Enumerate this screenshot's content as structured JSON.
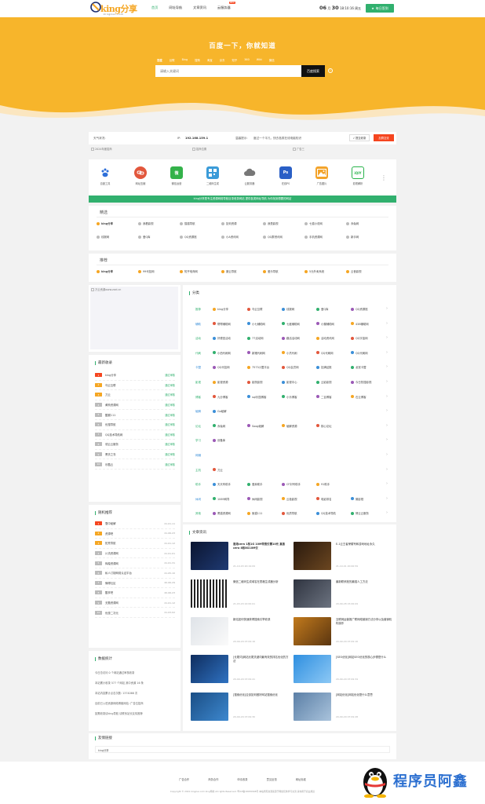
{
  "header": {
    "logo_text": "king",
    "logo_text_cn": "分享",
    "logo_url": "kingzuo.com",
    "nav": [
      "首页",
      "网址导航",
      "文章资讯",
      "云服务器"
    ],
    "nav_badge": "NEW",
    "date_month": "06",
    "date_month_unit": "月",
    "date_day": "30",
    "date_time": "18:10:16 周五",
    "signin": "每日签到"
  },
  "hero": {
    "title": "百度一下，你就知道",
    "engines": [
      "百度",
      "谷歌",
      "Bing",
      "搜狗",
      "淘宝",
      "京东",
      "知乎",
      "360",
      "Wiki",
      "微信"
    ],
    "placeholder": "请输入关键词",
    "search_button": "百度搜索"
  },
  "infobar": {
    "weather": "天气状况:",
    "ip_label": "IP:",
    "ip_value": "192.168.159.1",
    "tip_label": "温馨提示:",
    "tip_text": "度过一个平凡，快去各类在线电脑知识",
    "contribute": "√ 提交收录",
    "hot_button": "加群交流"
  },
  "ads": [
    "2024年度招商",
    "招商位置",
    "广告三"
  ],
  "apps": [
    {
      "label": "百度工具",
      "icon": "baidu-icon",
      "color": "#2e6fd9"
    },
    {
      "label": "网址压缩",
      "icon": "link-icon",
      "color": "#e2573c"
    },
    {
      "label": "微信运营",
      "icon": "wechat-icon",
      "color": "#34b24a"
    },
    {
      "label": "二维码生成",
      "icon": "qrcode-icon",
      "color": "#3b9bd8"
    },
    {
      "label": "云服务器",
      "icon": "cloud-icon",
      "color": "#777777"
    },
    {
      "label": "在线PS",
      "icon": "ps-icon",
      "color": "#2a5fc6"
    },
    {
      "label": "广告图片",
      "icon": "image-icon",
      "color": "#f3a32a"
    },
    {
      "label": "影视解析",
      "icon": "iqiyi-icon",
      "color": "#28b34a"
    }
  ],
  "notice": "king分享是专注资源网络导航目录收录网站 提供各类网址导航 为你找到想要的网站",
  "featured": {
    "title": "精选",
    "links": [
      "king分享",
      "我看影视",
      "猫猫导航",
      "如何资源",
      "我是影视",
      "七猫小说网",
      "赤兔网",
      "线报网",
      "爱Q库",
      "QQ资源馆",
      "小A资讯网",
      "QQ群资讯网",
      "手机资源网",
      "新手网"
    ]
  },
  "recommend": {
    "title": "推荐",
    "links": [
      "king分享",
      "99代挂网",
      "知乎电商网",
      "魔云导航",
      "爱乐导航",
      "5元外卖系统",
      "云音影视"
    ]
  },
  "left_ad": "万云资源www.zsei.cn",
  "latest": {
    "title": "最新收录",
    "status": "通过审核",
    "items": [
      "king分享",
      "乌云互联",
      "刀云",
      "黄狗资源网",
      "酷猴111",
      "优搜导航",
      "QQ技术导航网",
      "领云云服务",
      "黑衣之衣",
      "乐酷云"
    ]
  },
  "random": {
    "title": "随机推荐",
    "items": [
      {
        "name": "雪中破解",
        "date": "21-01-11"
      },
      {
        "name": "资源吧",
        "date": "21-06-23"
      },
      {
        "name": "拓荒导航",
        "date": "21-01-12"
      },
      {
        "name": "川流资源网",
        "date": "21-01-01"
      },
      {
        "name": "辉煌资源网",
        "date": "21-01-31"
      },
      {
        "name": "私人订制网络认证平台",
        "date": "21-05-10"
      },
      {
        "name": "懂得社区",
        "date": "20-06-29"
      },
      {
        "name": "酷享吧",
        "date": "20-06-23"
      },
      {
        "name": "无题资源网",
        "date": "21-01-12"
      },
      {
        "name": "优惠二次元",
        "date": "21-03-02"
      }
    ]
  },
  "stats": {
    "title": "数据统计",
    "lines": [
      "今日总访问  0  个网站通过审核收录",
      "本站累计收录  577  个网站 其中资源  16  条",
      "本站内容累计点击次数: 1374066 次",
      "目前已入驻资源网络博客网站: 广告位招商",
      "如需收录请king导航 请联系站长友情推荐"
    ]
  },
  "categories": {
    "title": "分类",
    "rows": [
      {
        "name": "推荐",
        "items": [
          "king分享",
          "乌云互联",
          "线报网",
          "爱Q库",
          "QQ资源馆"
        ]
      },
      {
        "name": "辅助",
        "items": [
          "帮帮辅助网",
          "小七辅助网",
          "七度辅助网",
          "小蝶辅助网",
          "438辅助网"
        ]
      },
      {
        "name": "活动",
        "items": [
          "好便宜活动",
          "77活动网",
          "趣活活动网",
          "活动资讯网",
          "QQ宇宙网"
        ]
      },
      {
        "name": "代刷",
        "items": [
          "小西代刷网",
          "新猪代刷网",
          "小杰代刷",
          "QQ代刷网",
          "QQ代刷网"
        ]
      },
      {
        "name": "卡盟",
        "items": [
          "QQ代挂网",
          "7573小盟平台",
          "QQ会员网",
          "挂满钻推",
          "龙宫卡盟"
        ]
      },
      {
        "name": "影视",
        "items": [
          "影视资源",
          "影院影视",
          "影视中心",
          "云影影视",
          "今日热搜影视"
        ]
      },
      {
        "name": "博客",
        "items": [
          "九分博客",
          "sql乐园博客",
          "小乐博客",
          "二百博客",
          "石云博客"
        ]
      },
      {
        "name": "破解",
        "items": [
          "Go破解"
        ]
      },
      {
        "name": "论坛",
        "items": [
          "赤兔网",
          "Soog破解",
          "破解资源",
          "核心论坛"
        ]
      },
      {
        "name": "学习",
        "items": [
          "设备库"
        ]
      },
      {
        "name": "网赚",
        "items": []
      },
      {
        "name": "主机",
        "items": [
          "刀云"
        ]
      },
      {
        "name": "助手",
        "items": [
          "天天有助手",
          "爱疯助手",
          "CF封号助手",
          "91助手"
        ]
      },
      {
        "name": "休闲",
        "items": [
          "1069网导",
          "休闲影视",
          "云极影视",
          "电影排名",
          "微影视"
        ]
      },
      {
        "name": "其他",
        "items": [
          "黑猫资源网",
          "鱼猫111",
          "优质导航",
          "QQ技术导航",
          "情云云服务"
        ]
      }
    ]
  },
  "news": {
    "title": "文章资讯",
    "items": [
      {
        "title": "香港cera 1核1G 10M带宽仅需10元 真香cera 8核8G10M仅",
        "date": "21-10-03 20:19:09",
        "bold": true
      },
      {
        "title": "E-1云王者荣耀号和游戏地址永久",
        "date": "21-10-01 20:06:59",
        "bold": false
      },
      {
        "title": "微信二维码生成域名在表格生成器分析",
        "date": "21-03-20 22:00:01",
        "bold": false
      },
      {
        "title": "最新联系账的最强人工方法",
        "date": "20-09-28 15:06:09",
        "bold": false
      },
      {
        "title": "新站如何快速获得搜索引擎收录",
        "date": "20-09-29 07:09:16",
        "bold": false
      },
      {
        "title": "互联网运营推广联网络营销方法分享以及营销机构操作",
        "date": "20-09-29 07:09:16",
        "bold": false
      },
      {
        "title": "[长尾词]网站长尾关键词最有效的排名优化的方法",
        "date": "20-09-29 07:09:41",
        "bold": false
      },
      {
        "title": "[SEO优化]网站SEO优化的核心步骤是什么",
        "date": "20-09-29 07:09:34",
        "bold": false
      },
      {
        "title": "[搜索优化]应该如何做好网站搜索优化",
        "date": "20-09-29 07:09:30",
        "bold": false
      },
      {
        "title": "[网站优化]网站优化是什么意思",
        "date": "20-09-29 07:09:28",
        "bold": false
      }
    ]
  },
  "friends": {
    "title": "友情链接",
    "links": [
      "king分享"
    ]
  },
  "footer": {
    "links": [
      "广告合作",
      "商务合作",
      "申请收录",
      "意见反馈",
      "网址标准"
    ],
    "copyright": "Copyright © 2021 kingzuo.com king导航 All rights Reserved.    粤ICP备18030998号    本站所有资源来源于网络仅供学习交流 请勿用于商业用途"
  },
  "watermark": "程序员阿鑫",
  "colors": {
    "accent": "#31b06e",
    "hero": "#f7b52b",
    "red": "#f5451f"
  }
}
